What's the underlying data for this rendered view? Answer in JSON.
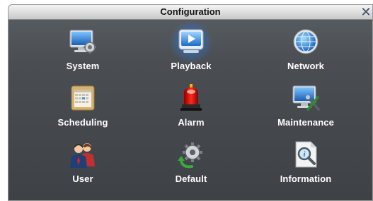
{
  "window": {
    "title": "Configuration",
    "close_symbol": "✕"
  },
  "menu": {
    "items": [
      {
        "label": "System",
        "icon": "monitor-gear-icon"
      },
      {
        "label": "Playback",
        "icon": "playback-icon",
        "selected": true
      },
      {
        "label": "Network",
        "icon": "globe-icon"
      },
      {
        "label": "Scheduling",
        "icon": "calendar-icon"
      },
      {
        "label": "Alarm",
        "icon": "siren-icon"
      },
      {
        "label": "Maintenance",
        "icon": "monitor-tools-icon"
      },
      {
        "label": "User",
        "icon": "users-icon"
      },
      {
        "label": "Default",
        "icon": "reset-gear-icon"
      },
      {
        "label": "Information",
        "icon": "document-magnifier-icon"
      }
    ]
  },
  "colors": {
    "panel": "#4a4e53",
    "label": "#ffffff",
    "highlight": "#3ca0ff"
  }
}
